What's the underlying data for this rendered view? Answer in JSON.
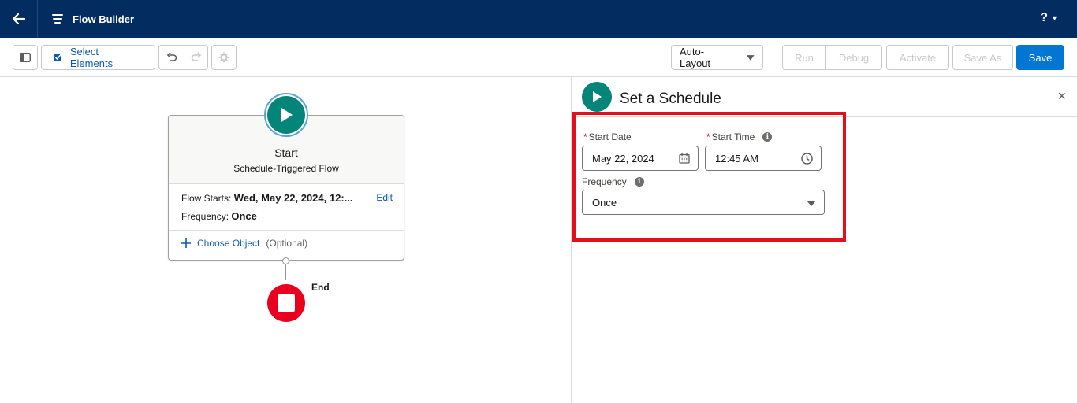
{
  "header": {
    "app_title": "Flow Builder",
    "help_label": "?",
    "back_icon": "back-arrow-icon",
    "app_icon": "flow-icon",
    "bg_color": "#032d60"
  },
  "toolbar": {
    "select_elements_label": "Select Elements",
    "layout_select_value": "Auto-Layout",
    "run_label": "Run",
    "debug_label": "Debug",
    "activate_label": "Activate",
    "save_as_label": "Save As",
    "save_label": "Save",
    "accent_color": "#0176d3"
  },
  "canvas": {
    "start_card": {
      "title": "Start",
      "subtitle": "Schedule-Triggered Flow",
      "flow_starts_label": "Flow Starts:",
      "flow_starts_value": "Wed, May 22, 2024, 12:...",
      "edit_label": "Edit",
      "frequency_label": "Frequency:",
      "frequency_value": "Once",
      "choose_object_label": "Choose Object",
      "choose_object_optional": "(Optional)"
    },
    "end_label": "End"
  },
  "panel": {
    "title": "Set a Schedule",
    "close_label": "×",
    "start_date_label": "Start Date",
    "start_date_value": "May 22, 2024",
    "start_time_label": "Start Time",
    "start_time_value": "12:45 AM",
    "frequency_label": "Frequency",
    "frequency_value": "Once",
    "required_mark": "*",
    "info_mark": "i",
    "highlight_color": "#e3101c"
  }
}
